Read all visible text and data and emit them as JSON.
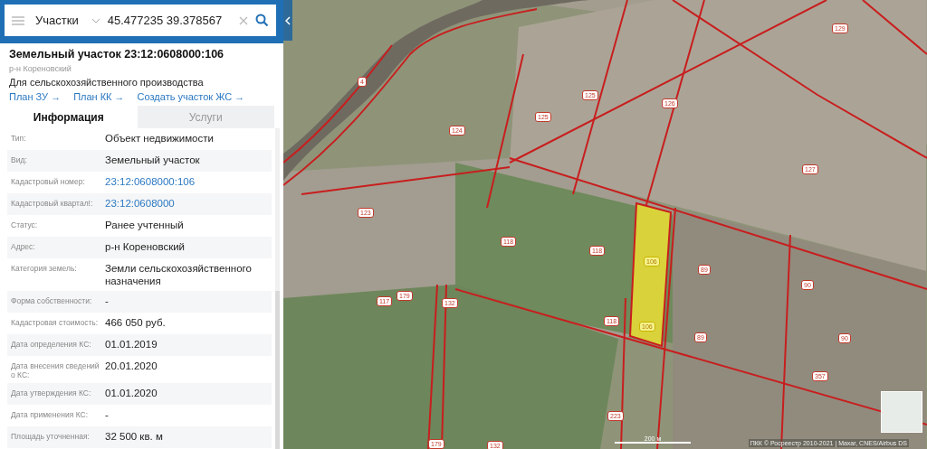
{
  "search": {
    "category": "Участки",
    "value": "45.477235 39.378567"
  },
  "object": {
    "title": "Земельный участок 23:12:0608000:106",
    "district": "р-н Кореновский",
    "purpose": "Для сельскохозяйственного производства",
    "links": [
      "План ЗУ →",
      "План КК →",
      "Создать участок ЖС →"
    ]
  },
  "tabs": [
    {
      "label": "Информация",
      "selected": true
    },
    {
      "label": "Услуги",
      "selected": false
    }
  ],
  "rows": [
    {
      "label": "Тип:",
      "value": "Объект недвижимости",
      "kind": "text"
    },
    {
      "label": "Вид:",
      "value": "Земельный участок",
      "kind": "text"
    },
    {
      "label": "Кадастровый номер:",
      "value": "23:12:0608000:106",
      "kind": "link"
    },
    {
      "label": "Кадастровый квартал!:",
      "value": "23:12:0608000",
      "kind": "link"
    },
    {
      "label": "Статус:",
      "value": "Ранее учтенный",
      "kind": "text"
    },
    {
      "label": "Адрес:",
      "value": "р-н Кореновский",
      "kind": "text"
    },
    {
      "label": "Категория земель:",
      "value": "Земли сельскохозяйственного назначения",
      "kind": "text"
    },
    {
      "label": "Форма собственности:",
      "value": "-",
      "kind": "text"
    },
    {
      "label": "Кадастровая стоимость:",
      "value": "466 050 руб.",
      "kind": "text"
    },
    {
      "label": "Дата определения КС:",
      "value": "01.01.2019",
      "kind": "text"
    },
    {
      "label": "Дата внесения сведений о КС:",
      "value": "20.01.2020",
      "kind": "text"
    },
    {
      "label": "Дата утверждения КС:",
      "value": "01.01.2020",
      "kind": "text"
    },
    {
      "label": "Дата применения КС:",
      "value": "-",
      "kind": "text"
    },
    {
      "label": "Площадь уточненная:",
      "value": "32 500 кв. м",
      "kind": "text"
    }
  ],
  "map": {
    "parcel_labels": [
      {
        "text": "4",
        "selected": false
      },
      {
        "text": "129",
        "selected": false
      },
      {
        "text": "125",
        "selected": false
      },
      {
        "text": "125",
        "selected": false
      },
      {
        "text": "126",
        "selected": false
      },
      {
        "text": "124",
        "selected": false
      },
      {
        "text": "127",
        "selected": false
      },
      {
        "text": "123",
        "selected": false
      },
      {
        "text": "118",
        "selected": false
      },
      {
        "text": "118",
        "selected": false
      },
      {
        "text": "106",
        "selected": true
      },
      {
        "text": "89",
        "selected": false
      },
      {
        "text": "90",
        "selected": false
      },
      {
        "text": "117",
        "selected": false
      },
      {
        "text": "179",
        "selected": false
      },
      {
        "text": "132",
        "selected": false
      },
      {
        "text": "118",
        "selected": false
      },
      {
        "text": "106",
        "selected": true
      },
      {
        "text": "89",
        "selected": false
      },
      {
        "text": "90",
        "selected": false
      },
      {
        "text": "357",
        "selected": false
      },
      {
        "text": "223",
        "selected": false
      },
      {
        "text": "179",
        "selected": false
      },
      {
        "text": "132",
        "selected": false
      }
    ],
    "scale": "200 м",
    "attribution": "ПКК © Росреестр 2010-2021 | Maxar, CNES/Airbus DS"
  }
}
